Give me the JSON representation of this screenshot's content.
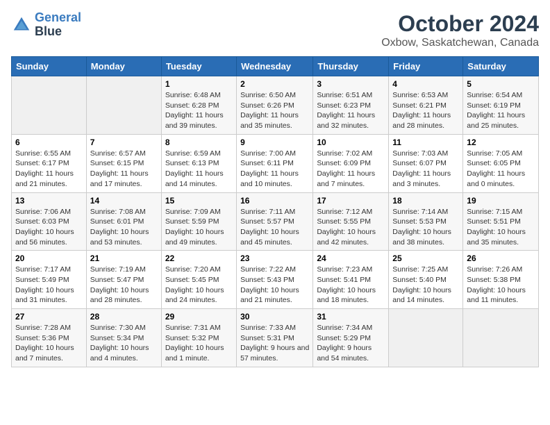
{
  "header": {
    "logo_line1": "General",
    "logo_line2": "Blue",
    "month": "October 2024",
    "location": "Oxbow, Saskatchewan, Canada"
  },
  "weekdays": [
    "Sunday",
    "Monday",
    "Tuesday",
    "Wednesday",
    "Thursday",
    "Friday",
    "Saturday"
  ],
  "weeks": [
    [
      {
        "day": "",
        "info": ""
      },
      {
        "day": "",
        "info": ""
      },
      {
        "day": "1",
        "info": "Sunrise: 6:48 AM\nSunset: 6:28 PM\nDaylight: 11 hours and 39 minutes."
      },
      {
        "day": "2",
        "info": "Sunrise: 6:50 AM\nSunset: 6:26 PM\nDaylight: 11 hours and 35 minutes."
      },
      {
        "day": "3",
        "info": "Sunrise: 6:51 AM\nSunset: 6:23 PM\nDaylight: 11 hours and 32 minutes."
      },
      {
        "day": "4",
        "info": "Sunrise: 6:53 AM\nSunset: 6:21 PM\nDaylight: 11 hours and 28 minutes."
      },
      {
        "day": "5",
        "info": "Sunrise: 6:54 AM\nSunset: 6:19 PM\nDaylight: 11 hours and 25 minutes."
      }
    ],
    [
      {
        "day": "6",
        "info": "Sunrise: 6:55 AM\nSunset: 6:17 PM\nDaylight: 11 hours and 21 minutes."
      },
      {
        "day": "7",
        "info": "Sunrise: 6:57 AM\nSunset: 6:15 PM\nDaylight: 11 hours and 17 minutes."
      },
      {
        "day": "8",
        "info": "Sunrise: 6:59 AM\nSunset: 6:13 PM\nDaylight: 11 hours and 14 minutes."
      },
      {
        "day": "9",
        "info": "Sunrise: 7:00 AM\nSunset: 6:11 PM\nDaylight: 11 hours and 10 minutes."
      },
      {
        "day": "10",
        "info": "Sunrise: 7:02 AM\nSunset: 6:09 PM\nDaylight: 11 hours and 7 minutes."
      },
      {
        "day": "11",
        "info": "Sunrise: 7:03 AM\nSunset: 6:07 PM\nDaylight: 11 hours and 3 minutes."
      },
      {
        "day": "12",
        "info": "Sunrise: 7:05 AM\nSunset: 6:05 PM\nDaylight: 11 hours and 0 minutes."
      }
    ],
    [
      {
        "day": "13",
        "info": "Sunrise: 7:06 AM\nSunset: 6:03 PM\nDaylight: 10 hours and 56 minutes."
      },
      {
        "day": "14",
        "info": "Sunrise: 7:08 AM\nSunset: 6:01 PM\nDaylight: 10 hours and 53 minutes."
      },
      {
        "day": "15",
        "info": "Sunrise: 7:09 AM\nSunset: 5:59 PM\nDaylight: 10 hours and 49 minutes."
      },
      {
        "day": "16",
        "info": "Sunrise: 7:11 AM\nSunset: 5:57 PM\nDaylight: 10 hours and 45 minutes."
      },
      {
        "day": "17",
        "info": "Sunrise: 7:12 AM\nSunset: 5:55 PM\nDaylight: 10 hours and 42 minutes."
      },
      {
        "day": "18",
        "info": "Sunrise: 7:14 AM\nSunset: 5:53 PM\nDaylight: 10 hours and 38 minutes."
      },
      {
        "day": "19",
        "info": "Sunrise: 7:15 AM\nSunset: 5:51 PM\nDaylight: 10 hours and 35 minutes."
      }
    ],
    [
      {
        "day": "20",
        "info": "Sunrise: 7:17 AM\nSunset: 5:49 PM\nDaylight: 10 hours and 31 minutes."
      },
      {
        "day": "21",
        "info": "Sunrise: 7:19 AM\nSunset: 5:47 PM\nDaylight: 10 hours and 28 minutes."
      },
      {
        "day": "22",
        "info": "Sunrise: 7:20 AM\nSunset: 5:45 PM\nDaylight: 10 hours and 24 minutes."
      },
      {
        "day": "23",
        "info": "Sunrise: 7:22 AM\nSunset: 5:43 PM\nDaylight: 10 hours and 21 minutes."
      },
      {
        "day": "24",
        "info": "Sunrise: 7:23 AM\nSunset: 5:41 PM\nDaylight: 10 hours and 18 minutes."
      },
      {
        "day": "25",
        "info": "Sunrise: 7:25 AM\nSunset: 5:40 PM\nDaylight: 10 hours and 14 minutes."
      },
      {
        "day": "26",
        "info": "Sunrise: 7:26 AM\nSunset: 5:38 PM\nDaylight: 10 hours and 11 minutes."
      }
    ],
    [
      {
        "day": "27",
        "info": "Sunrise: 7:28 AM\nSunset: 5:36 PM\nDaylight: 10 hours and 7 minutes."
      },
      {
        "day": "28",
        "info": "Sunrise: 7:30 AM\nSunset: 5:34 PM\nDaylight: 10 hours and 4 minutes."
      },
      {
        "day": "29",
        "info": "Sunrise: 7:31 AM\nSunset: 5:32 PM\nDaylight: 10 hours and 1 minute."
      },
      {
        "day": "30",
        "info": "Sunrise: 7:33 AM\nSunset: 5:31 PM\nDaylight: 9 hours and 57 minutes."
      },
      {
        "day": "31",
        "info": "Sunrise: 7:34 AM\nSunset: 5:29 PM\nDaylight: 9 hours and 54 minutes."
      },
      {
        "day": "",
        "info": ""
      },
      {
        "day": "",
        "info": ""
      }
    ]
  ]
}
